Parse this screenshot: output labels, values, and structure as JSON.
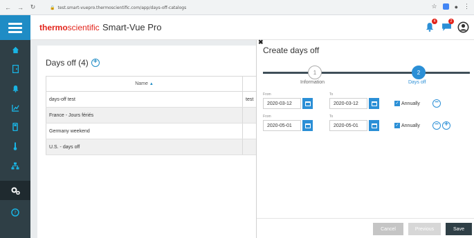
{
  "browser": {
    "url": "test.smart-vuepro.thermoscientific.com/app/days-off-catalogs",
    "notifications_badge": "4",
    "messages_badge": "2"
  },
  "app": {
    "brand_bold": "thermo",
    "brand_rest": "scientific",
    "title": "Smart-Vue Pro"
  },
  "sidebar": {
    "items": [
      {
        "icon": "home-icon"
      },
      {
        "icon": "door-icon"
      },
      {
        "icon": "bell-icon"
      },
      {
        "icon": "chart-icon"
      },
      {
        "icon": "sensor-icon"
      },
      {
        "icon": "thermometer-icon"
      },
      {
        "icon": "hierarchy-icon"
      },
      {
        "icon": "settings-icon",
        "active": true
      },
      {
        "icon": "help-icon"
      }
    ]
  },
  "days_off": {
    "title": "Days off (4)",
    "column_name": "Name",
    "rows": [
      {
        "name": "days-off test",
        "extra": "test"
      },
      {
        "name": "France - Jours fériés",
        "extra": ""
      },
      {
        "name": "Germany weekend",
        "extra": ""
      },
      {
        "name": "U.S. - days off",
        "extra": ""
      }
    ]
  },
  "panel": {
    "title": "Create days off",
    "steps": [
      {
        "number": "1",
        "label": "Information"
      },
      {
        "number": "2",
        "label": "Days off"
      }
    ],
    "from_label": "From",
    "to_label": "To",
    "ranges": [
      {
        "from": "2020-03-12",
        "to": "2020-03-12",
        "annually_label": "Annually"
      },
      {
        "from": "2020-05-01",
        "to": "2020-05-01",
        "annually_label": "Annually"
      }
    ],
    "buttons": {
      "cancel": "Cancel",
      "previous": "Previous",
      "save": "Save"
    }
  },
  "colors": {
    "accent": "#2b8fd6",
    "sidebar_bg": "#2f3f46",
    "brand_red": "#e2231a"
  }
}
